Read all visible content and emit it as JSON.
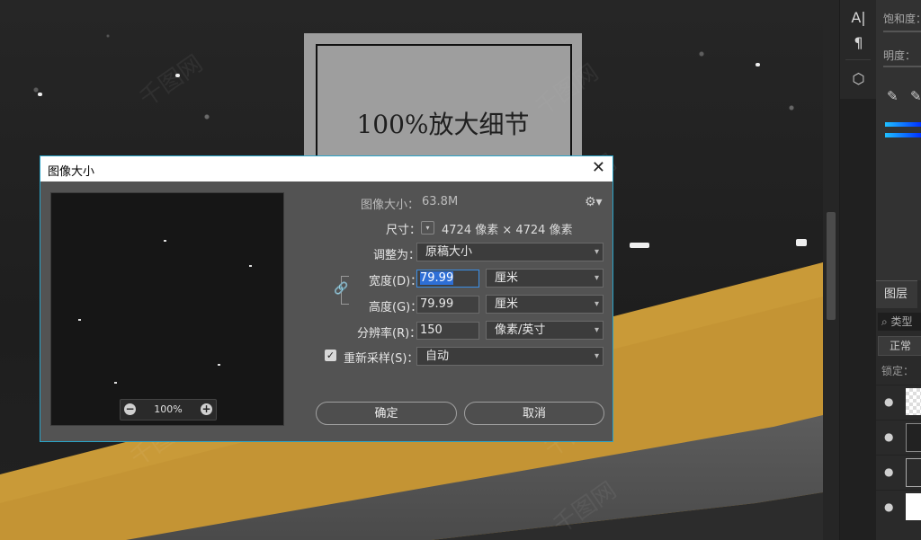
{
  "canvas": {
    "zoom_caption": "100%放大细节",
    "watermark": "千图网"
  },
  "toolstrip": {
    "items": [
      "A|",
      "¶",
      "⬡"
    ]
  },
  "adjust_panel": {
    "saturation_label": "饱和度：",
    "brightness_label": "明度："
  },
  "layers_panel": {
    "tab": "图层",
    "search_placeholder": "类型",
    "blend_mode": "正常",
    "lock_label": "锁定："
  },
  "dialog": {
    "title": "图像大小",
    "image_size_label": "图像大小：",
    "image_size_value": "63.8M",
    "dimensions_label": "尺寸：",
    "dimensions_value": "4724 像素 × 4724 像素",
    "fit_label": "调整为：",
    "fit_value": "原稿大小",
    "width_label": "宽度(D)：",
    "width_value": "79.99",
    "width_unit": "厘米",
    "height_label": "高度(G)：",
    "height_value": "79.99",
    "height_unit": "厘米",
    "resolution_label": "分辨率(R)：",
    "resolution_value": "150",
    "resolution_unit": "像素/英寸",
    "resample_label": "重新采样(S)：",
    "resample_value": "自动",
    "resample_checked": true,
    "preview_zoom": "100%",
    "ok_label": "确定",
    "cancel_label": "取消"
  }
}
